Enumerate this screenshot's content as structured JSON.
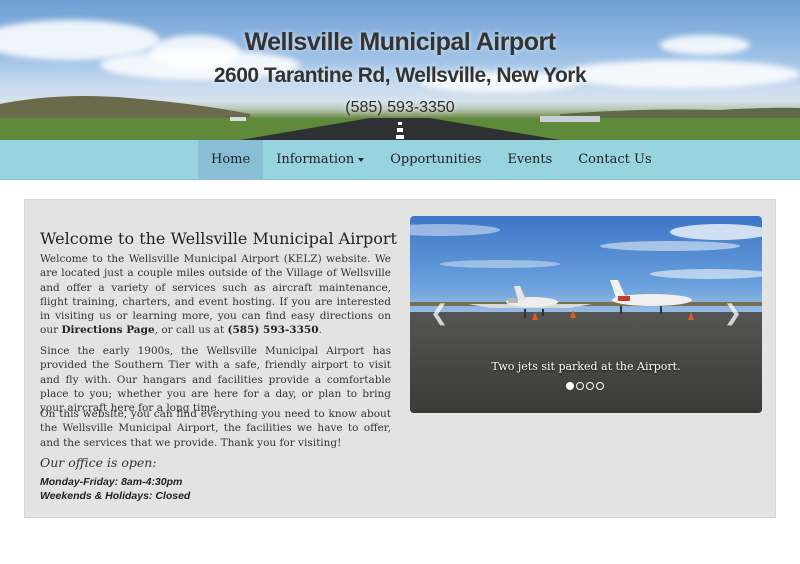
{
  "header": {
    "title": "Wellsville Municipal Airport",
    "address": "2600 Tarantine Rd, Wellsville, New York",
    "phone": "(585) 593-3350"
  },
  "nav": {
    "items": [
      {
        "label": "Home",
        "active": true
      },
      {
        "label": "Information",
        "dropdown": true
      },
      {
        "label": "Opportunities"
      },
      {
        "label": "Events"
      },
      {
        "label": "Contact Us"
      }
    ]
  },
  "main": {
    "heading": "Welcome to the Wellsville Municipal Airport",
    "p1_a": "Welcome to the Wellsville Municipal Airport (KELZ) website. We are located just a couple miles outside of the Village of Wellsville and offer a variety of services such as aircraft maintenance, flight training, charters, and event hosting. If you are interested in visiting us or learning more, you can find easy directions on our ",
    "p1_link": "Directions Page",
    "p1_b": ", or call us at ",
    "p1_phone": "(585) 593-3350",
    "p1_c": ".",
    "p2": "Since the early 1900s, the Wellsville Municipal Airport has provided the Southern Tier with a safe, friendly airport to visit and fly with. Our hangars and facilities provide a comfortable place to you; whether you are here for a day, or plan to bring your aircraft here for a long time.",
    "p3": "On this website, you can find everything you need to know about the Wellsville Municipal Airport, the facilities we have to offer, and the services that we provide. Thank you for visiting!",
    "office_heading": "Our office is open:",
    "hours_weekday": "Monday-Friday: 8am-4:30pm",
    "hours_weekend": "Weekends & Holidays: Closed"
  },
  "carousel": {
    "caption": "Two jets sit parked at the Airport.",
    "prev_icon": "chevron-left-icon",
    "next_icon": "chevron-right-icon",
    "slide_count": 4,
    "active_index": 0
  },
  "colors": {
    "nav_bg": "#98d3e0",
    "nav_active": "#88bfd6",
    "panel_bg": "#e3e3e3"
  }
}
